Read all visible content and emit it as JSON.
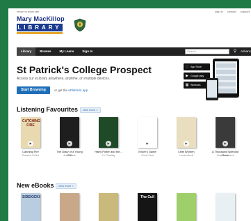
{
  "topbar": {
    "back_label": "return to main site",
    "links": [
      "sign in",
      "contact",
      "support"
    ]
  },
  "logo": {
    "name": "Mary MacKillop",
    "sub": "LIBRARY"
  },
  "nav": {
    "items": [
      "Library",
      "Browse",
      "My Loans",
      "Sign In"
    ],
    "active": "Library",
    "search_placeholder": "Search...",
    "advanced_label": "Advanced"
  },
  "hero": {
    "title": "St Patrick's College Prospect",
    "subtitle": "Access our eLibrary anywhere, anytime, on multiple devices.",
    "browse_label": "Start Browsing",
    "or_text": "or get the",
    "app_link": "ePlatform app"
  },
  "stores": [
    "App Store",
    "Google play",
    "Windows"
  ],
  "listening": {
    "title": "Listening Favourites",
    "see_more": "view more >",
    "books": [
      {
        "title": "Catching Fire",
        "author": "Suzanne Collins",
        "cover": "CATCHING FIRE",
        "bg": "#e8d9b0",
        "fg": "#7a1f12"
      },
      {
        "title": "The Diary of a Young Girl",
        "author": "Anne Frank",
        "cover": "",
        "bg": "#1e1e1e",
        "fg": "#ffffff"
      },
      {
        "title": "Harry Potter and the...",
        "author": "J.K. Rowling",
        "cover": "",
        "bg": "#1f4a28",
        "fg": "#f0d27a"
      },
      {
        "title": "Ender's Game",
        "author": "Orson Card",
        "cover": "",
        "bg": "#ffffff",
        "fg": "#111111"
      },
      {
        "title": "Little Women",
        "author": "Louisa Alcott",
        "cover": "",
        "bg": "#e9dfc0",
        "fg": "#6a4a2a"
      },
      {
        "title": "A Thousand Splendid Suns",
        "author": "Khaled Hosseini",
        "cover": "",
        "bg": "#3a3a3a",
        "fg": "#f5e6c8"
      }
    ]
  },
  "ebooks": {
    "title": "New eBooks",
    "see_more": "view more >",
    "books": [
      {
        "cover": "SIDEKICKS",
        "bg": "#b9cde0",
        "fg": "#1b2f5e"
      },
      {
        "cover": "",
        "bg": "#c8a888",
        "fg": "#3a2a1a"
      },
      {
        "cover": "",
        "bg": "#c9b97a",
        "fg": "#3a2a1a"
      },
      {
        "cover": "The Cull",
        "bg": "#151515",
        "fg": "#ffffff"
      },
      {
        "cover": "",
        "bg": "#9fcf6a",
        "fg": "#2a4a1a"
      },
      {
        "cover": "",
        "bg": "#e9f0f4",
        "fg": "#2a4a6a"
      }
    ]
  }
}
